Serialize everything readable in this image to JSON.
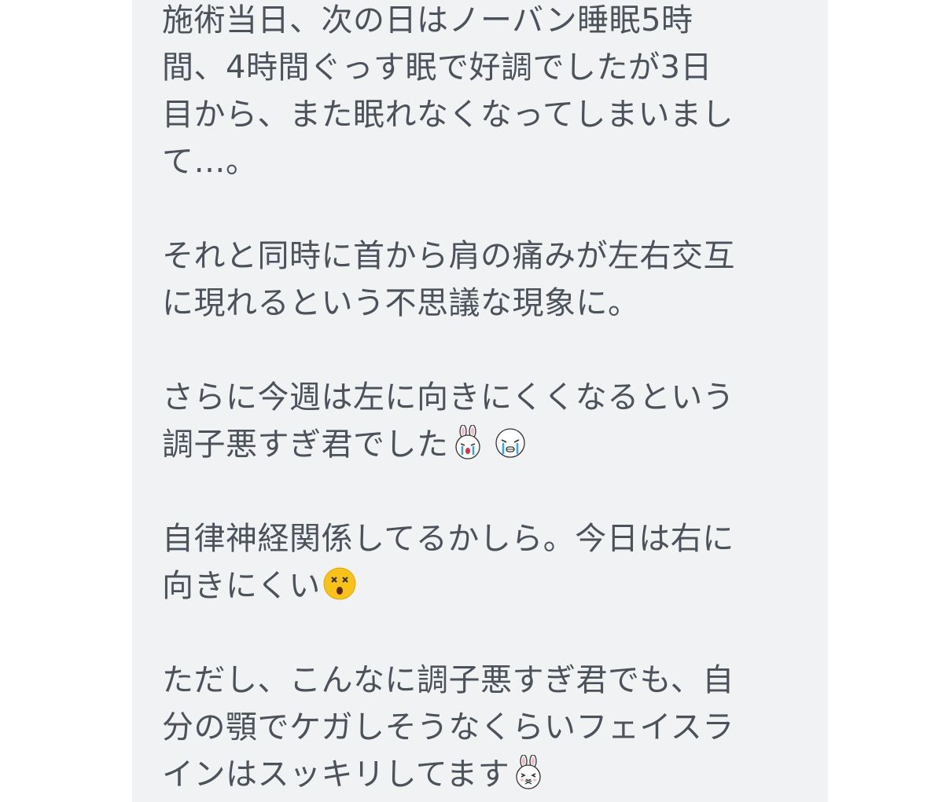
{
  "post": {
    "p1": {
      "l1": "施術当日、次の日はノーバン睡眠5時",
      "l2": "間、4時間ぐっす眠で好調でしたが3日",
      "l3": "目から、また眠れなくなってしまいまし",
      "l4": "て…。"
    },
    "p2": {
      "l1": "それと同時に首から肩の痛みが左右交互",
      "l2": "に現れるという不思議な現象に。"
    },
    "p3": {
      "l1": "さらに今週は左に向きにくくなるという",
      "l2": "調子悪すぎ君でした"
    },
    "p4": {
      "l1": "自律神経関係してるかしら。今日は右に",
      "l2": "向きにくい"
    },
    "p5": {
      "l1": "ただし、こんなに調子悪すぎ君でも、自",
      "l2": "分の顎でケガしそうなくらいフェイスラ",
      "l3": "インはスッキリしてます"
    }
  },
  "emojis": {
    "cony_crying": "cony-crying-icon",
    "moon_crying": "moon-crying-icon",
    "dizzy_face": "dizzy-face-icon",
    "cony_happy": "cony-happy-icon"
  },
  "colors": {
    "bubble_bg": "#f1f2f4",
    "text": "#4c525b",
    "page_bg": "#ffffff"
  }
}
